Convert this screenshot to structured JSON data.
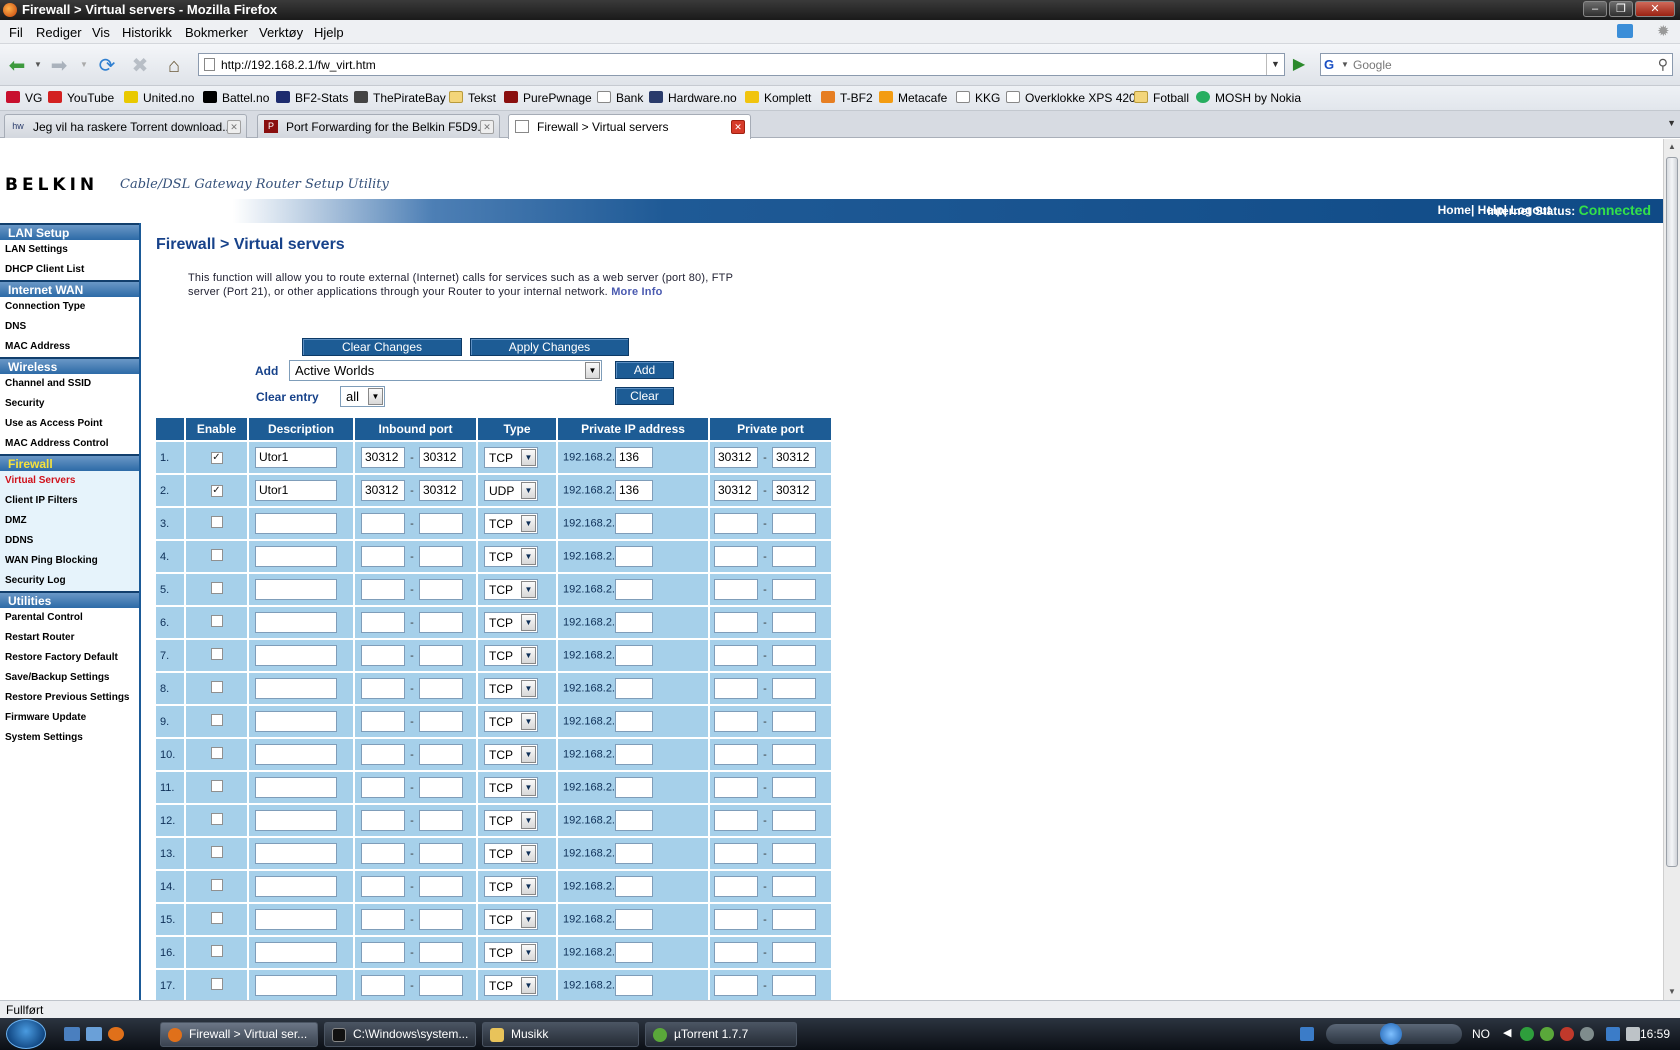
{
  "window": {
    "title": "Firewall > Virtual servers - Mozilla Firefox"
  },
  "menu": [
    "Fil",
    "Rediger",
    "Vis",
    "Historikk",
    "Bokmerker",
    "Verktøy",
    "Hjelp"
  ],
  "nav": {
    "url": "http://192.168.2.1/fw_virt.htm",
    "search_placeholder": "Google"
  },
  "bookmarks": [
    "VG",
    "YouTube",
    "United.no",
    "Battel.no",
    "BF2-Stats",
    "ThePirateBay",
    "Tekst",
    "PurePwnage",
    "Bank",
    "Hardware.no",
    "Komplett",
    "T-BF2",
    "Metacafe",
    "KKG",
    "Overklokke XPS 420",
    "Fotball",
    "MOSH by Nokia"
  ],
  "tabs": [
    {
      "label": "Jeg vil ha raskere Torrent download...",
      "active": false
    },
    {
      "label": "Port Forwarding for the Belkin F5D9...",
      "active": false
    },
    {
      "label": "Firewall > Virtual servers",
      "active": true
    }
  ],
  "header": {
    "logo": "BELKIN",
    "subtitle": "Cable/DSL Gateway Router Setup Utility",
    "links": "Home| Help| Logout",
    "status_label": "Internet Status:",
    "status_value": "Connected",
    "status_color": "#33e04a"
  },
  "sidebar": [
    {
      "section": "LAN Setup",
      "items": [
        "LAN Settings",
        "DHCP Client List"
      ]
    },
    {
      "section": "Internet WAN",
      "items": [
        "Connection Type",
        "DNS",
        "MAC Address"
      ]
    },
    {
      "section": "Wireless",
      "items": [
        "Channel and SSID",
        "Security",
        "Use as Access Point",
        "MAC Address Control"
      ]
    },
    {
      "section": "Firewall",
      "items": [
        "Virtual Servers",
        "Client IP Filters",
        "DMZ",
        "DDNS",
        "WAN Ping Blocking",
        "Security Log"
      ],
      "selected": "Virtual Servers"
    },
    {
      "section": "Utilities",
      "items": [
        "Parental Control",
        "Restart Router",
        "Restore Factory Default",
        "Save/Backup Settings",
        "Restore Previous Settings",
        "Firmware Update",
        "System Settings"
      ]
    }
  ],
  "main": {
    "title": "Firewall > Virtual servers",
    "description": "This function will allow you to route external (Internet) calls for services such as a web server (port 80), FTP server (Port 21), or other applications through your Router to your internal network.",
    "more_info": "More Info",
    "clear_changes": "Clear Changes",
    "apply_changes": "Apply Changes",
    "add_label": "Add",
    "add_value": "Active Worlds",
    "add_button": "Add",
    "clear_entry_label": "Clear entry",
    "clear_entry_value": "all",
    "clear_button": "Clear"
  },
  "table": {
    "headers": [
      "",
      "Enable",
      "Description",
      "Inbound port",
      "Type",
      "Private IP address",
      "Private port"
    ],
    "ip_prefix": "192.168.2.",
    "rows": [
      {
        "num": "1.",
        "enabled": true,
        "desc": "Utor1",
        "in_from": "30312",
        "in_to": "30312",
        "type": "TCP",
        "ip": "136",
        "pp_from": "30312",
        "pp_to": "30312"
      },
      {
        "num": "2.",
        "enabled": true,
        "desc": "Utor1",
        "in_from": "30312",
        "in_to": "30312",
        "type": "UDP",
        "ip": "136",
        "pp_from": "30312",
        "pp_to": "30312"
      },
      {
        "num": "3.",
        "enabled": false,
        "desc": "",
        "in_from": "",
        "in_to": "",
        "type": "TCP",
        "ip": "",
        "pp_from": "",
        "pp_to": ""
      },
      {
        "num": "4.",
        "enabled": false,
        "desc": "",
        "in_from": "",
        "in_to": "",
        "type": "TCP",
        "ip": "",
        "pp_from": "",
        "pp_to": ""
      },
      {
        "num": "5.",
        "enabled": false,
        "desc": "",
        "in_from": "",
        "in_to": "",
        "type": "TCP",
        "ip": "",
        "pp_from": "",
        "pp_to": ""
      },
      {
        "num": "6.",
        "enabled": false,
        "desc": "",
        "in_from": "",
        "in_to": "",
        "type": "TCP",
        "ip": "",
        "pp_from": "",
        "pp_to": ""
      },
      {
        "num": "7.",
        "enabled": false,
        "desc": "",
        "in_from": "",
        "in_to": "",
        "type": "TCP",
        "ip": "",
        "pp_from": "",
        "pp_to": ""
      },
      {
        "num": "8.",
        "enabled": false,
        "desc": "",
        "in_from": "",
        "in_to": "",
        "type": "TCP",
        "ip": "",
        "pp_from": "",
        "pp_to": ""
      },
      {
        "num": "9.",
        "enabled": false,
        "desc": "",
        "in_from": "",
        "in_to": "",
        "type": "TCP",
        "ip": "",
        "pp_from": "",
        "pp_to": ""
      },
      {
        "num": "10.",
        "enabled": false,
        "desc": "",
        "in_from": "",
        "in_to": "",
        "type": "TCP",
        "ip": "",
        "pp_from": "",
        "pp_to": ""
      },
      {
        "num": "11.",
        "enabled": false,
        "desc": "",
        "in_from": "",
        "in_to": "",
        "type": "TCP",
        "ip": "",
        "pp_from": "",
        "pp_to": ""
      },
      {
        "num": "12.",
        "enabled": false,
        "desc": "",
        "in_from": "",
        "in_to": "",
        "type": "TCP",
        "ip": "",
        "pp_from": "",
        "pp_to": ""
      },
      {
        "num": "13.",
        "enabled": false,
        "desc": "",
        "in_from": "",
        "in_to": "",
        "type": "TCP",
        "ip": "",
        "pp_from": "",
        "pp_to": ""
      },
      {
        "num": "14.",
        "enabled": false,
        "desc": "",
        "in_from": "",
        "in_to": "",
        "type": "TCP",
        "ip": "",
        "pp_from": "",
        "pp_to": ""
      },
      {
        "num": "15.",
        "enabled": false,
        "desc": "",
        "in_from": "",
        "in_to": "",
        "type": "TCP",
        "ip": "",
        "pp_from": "",
        "pp_to": ""
      },
      {
        "num": "16.",
        "enabled": false,
        "desc": "",
        "in_from": "",
        "in_to": "",
        "type": "TCP",
        "ip": "",
        "pp_from": "",
        "pp_to": ""
      },
      {
        "num": "17.",
        "enabled": false,
        "desc": "",
        "in_from": "",
        "in_to": "",
        "type": "TCP",
        "ip": "",
        "pp_from": "",
        "pp_to": ""
      }
    ]
  },
  "statusbar": {
    "text": "Fullført"
  },
  "taskbar": {
    "tasks": [
      "Firewall > Virtual ser...",
      "C:\\Windows\\system...",
      "Musikk",
      "µTorrent 1.7.7"
    ],
    "lang": "NO",
    "clock": "16:59"
  }
}
